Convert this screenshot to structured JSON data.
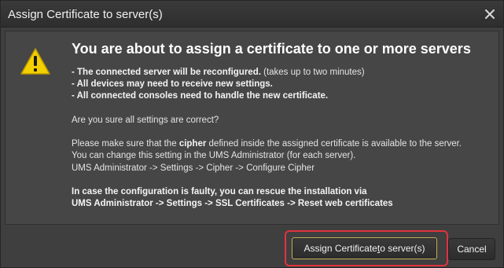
{
  "window": {
    "title": "Assign Certificate to server(s)"
  },
  "dialog": {
    "heading": "You are about to assign a certificate to one or more servers",
    "lines": [
      {
        "bold": "- The connected server will be reconfigured.",
        "normal": " (takes up to two minutes)"
      },
      {
        "bold": "- All devices may need to receive new settings.",
        "normal": ""
      },
      {
        "bold": "- All connected consoles need to handle the new certificate.",
        "normal": ""
      }
    ],
    "question": "Are you sure all settings are correct?",
    "cipher": {
      "pre": "Please make sure that the ",
      "bold": "cipher",
      "post": " defined inside the assigned certificate is available to the server.",
      "line2": "You can change this setting in the UMS Administrator (for each server).",
      "line3": "UMS Administrator -> Settings -> Cipher -> Configure Cipher"
    },
    "rescue": {
      "line1": "In case the configuration is faulty, you can rescue the installation via",
      "line2": "UMS Administrator -> Settings -> SSL Certificates -> Reset web certificates"
    }
  },
  "buttons": {
    "assign_pre": "Assign Certificate ",
    "assign_mnemonic": "t",
    "assign_post": "o server(s)",
    "cancel": "Cancel"
  },
  "colors": {
    "highlight": "#e0333d",
    "warning": "#f5d000",
    "focus_border": "#c8b25a"
  },
  "icons": {
    "warning": "warning-triangle-icon",
    "close": "close-icon"
  }
}
